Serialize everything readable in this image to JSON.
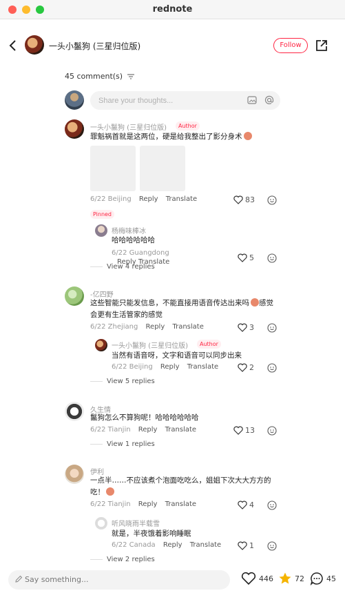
{
  "window": {
    "title": "rednote"
  },
  "header": {
    "author_name": "一头小鬣狗 (三星归位版)",
    "follow_label": "Follow"
  },
  "comments_count": "45 comment(s)",
  "composer": {
    "placeholder": "Share your thoughts..."
  },
  "comments": [
    {
      "name": "一头小鬣狗 (三星归位版)",
      "badge": "Author",
      "text": "罪魁祸首就是这两位，硬是给我整出了影分身术",
      "meta_location": "6/22 Beijing",
      "reply_label": "Reply",
      "translate_label": "Translate",
      "likes": "83",
      "pinned": "Pinned",
      "replies": [
        {
          "name": "杨梅味棒冰",
          "text": "哈哈哈哈哈哈",
          "meta_location": "6/22 Guangdong",
          "reply_label": "Reply",
          "translate_label": "Translate",
          "likes": "5"
        }
      ],
      "view_replies": "View 4 replies"
    },
    {
      "name": "-亿四野",
      "text": "这些智能只能发信息，不能直接用语音传达出来吗",
      "text2": "感觉会更有生活管家的感觉",
      "meta_location": "6/22 Zhejiang",
      "reply_label": "Reply",
      "translate_label": "Translate",
      "likes": "3",
      "replies": [
        {
          "name": "一头小鬣狗 (三星归位版)",
          "badge": "Author",
          "text": "当然有语音呀，文字和语音可以同步出来",
          "meta_location": "6/22 Beijing",
          "reply_label": "Reply",
          "translate_label": "Translate",
          "likes": "2"
        }
      ],
      "view_replies": "View 5 replies"
    },
    {
      "name": "久生情",
      "text": "鬣狗怎么不算狗呢！哈哈哈哈哈哈",
      "meta_location": "6/22 Tianjin",
      "reply_label": "Reply",
      "translate_label": "Translate",
      "likes": "13",
      "view_replies": "View 1 replies"
    },
    {
      "name": "伊利",
      "text": "一点半……不应该煮个泡面吃吃么，姐姐下次大大方方的",
      "text2": "吃！",
      "meta_location": "6/22 Tianjin",
      "reply_label": "Reply",
      "translate_label": "Translate",
      "likes": "4",
      "replies": [
        {
          "name": "听风晓雨半载雪",
          "text": "就是，半夜饿着影响睡眠",
          "meta_location": "6/22 Canada",
          "reply_label": "Reply",
          "translate_label": "Translate",
          "likes": "1"
        }
      ],
      "view_replies": "View 2 replies"
    }
  ],
  "bottom": {
    "say_placeholder": "Say something...",
    "likes": "446",
    "collects": "72",
    "comments": "45"
  },
  "colors": {
    "accent": "#ff2442",
    "star": "#f5b400"
  }
}
